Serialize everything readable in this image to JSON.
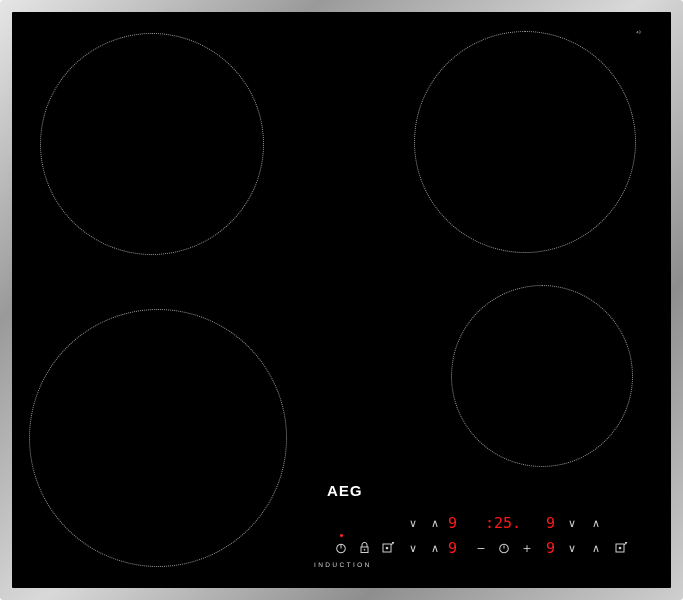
{
  "brand": "AEG",
  "subtitle": "INDUCTION",
  "corner_mark": "⁴³",
  "colors": {
    "glass": "#000000",
    "frame": "#b3b3b3",
    "display": "#ff1a1a",
    "controls": "#d0d0d0"
  },
  "icons": {
    "power": "power-icon",
    "lock": "lock-icon",
    "bridge_left": "bridge-icon",
    "bridge_right": "bridge-icon",
    "timer": "timer-icon"
  },
  "controls": {
    "down": "∨",
    "up": "∧",
    "minus": "−",
    "plus": "+"
  },
  "displays": {
    "top_left_level": "9",
    "timer": ":25.",
    "top_right_level": "9",
    "bottom_left_level": "9",
    "bottom_right_level": "9"
  }
}
